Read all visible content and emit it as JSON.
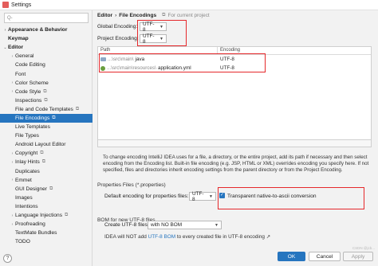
{
  "window": {
    "title": "Settings"
  },
  "search": {
    "placeholder": "Q-"
  },
  "sidebar": {
    "items": [
      {
        "label": "Appearance & Behavior",
        "arrow": "›",
        "level": 0,
        "bold": true
      },
      {
        "label": "Keymap",
        "arrow": "",
        "level": 0,
        "bold": true
      },
      {
        "label": "Editor",
        "arrow": "⌄",
        "level": 0,
        "bold": true
      },
      {
        "label": "General",
        "arrow": "›",
        "level": 1
      },
      {
        "label": "Code Editing",
        "arrow": "",
        "level": 1
      },
      {
        "label": "Font",
        "arrow": "",
        "level": 1
      },
      {
        "label": "Color Scheme",
        "arrow": "›",
        "level": 1
      },
      {
        "label": "Code Style",
        "arrow": "›",
        "level": 1,
        "scope": "⧉"
      },
      {
        "label": "Inspections",
        "arrow": "",
        "level": 1,
        "scope": "⧉"
      },
      {
        "label": "File and Code Templates",
        "arrow": "",
        "level": 1,
        "scope": "⧉"
      },
      {
        "label": "File Encodings",
        "arrow": "",
        "level": 1,
        "scope": "⧉",
        "selected": true
      },
      {
        "label": "Live Templates",
        "arrow": "",
        "level": 1
      },
      {
        "label": "File Types",
        "arrow": "",
        "level": 1
      },
      {
        "label": "Android Layout Editor",
        "arrow": "",
        "level": 1
      },
      {
        "label": "Copyright",
        "arrow": "›",
        "level": 1,
        "scope": "⧉"
      },
      {
        "label": "Inlay Hints",
        "arrow": "›",
        "level": 1,
        "scope": "⧉"
      },
      {
        "label": "Duplicates",
        "arrow": "",
        "level": 1
      },
      {
        "label": "Emmet",
        "arrow": "›",
        "level": 1
      },
      {
        "label": "GUI Designer",
        "arrow": "",
        "level": 1,
        "scope": "⧉"
      },
      {
        "label": "Images",
        "arrow": "",
        "level": 1
      },
      {
        "label": "Intentions",
        "arrow": "",
        "level": 1
      },
      {
        "label": "Language Injections",
        "arrow": "›",
        "level": 1,
        "scope": "⧉"
      },
      {
        "label": "Proofreading",
        "arrow": "›",
        "level": 1
      },
      {
        "label": "TextMate Bundles",
        "arrow": "",
        "level": 1
      },
      {
        "label": "TODO",
        "arrow": "",
        "level": 1
      }
    ]
  },
  "breadcrumb": {
    "parent": "Editor",
    "separator": "›",
    "current": "File Encodings",
    "scope_icon": "⧉",
    "scope_text": "For current project"
  },
  "encoding": {
    "global_label": "Global Encoding:",
    "global_value": "UTF-8",
    "project_label": "Project Encoding:",
    "project_value": "UTF-8"
  },
  "table": {
    "headers": [
      "Path",
      "Encoding"
    ],
    "rows": [
      {
        "path_prefix": "...\\src\\main\\",
        "path_name": "java",
        "encoding": "UTF-8",
        "icon": "folder-icon"
      },
      {
        "path_prefix": "...\\src\\main\\resources\\",
        "path_name": "application.yml",
        "encoding": "UTF-8",
        "icon": "yaml-file-icon"
      }
    ]
  },
  "info_text": "To change encoding IntelliJ IDEA uses for a file, a directory, or the entire project, add its path if necessary and then select encoding from the Encoding list. Built-in file encoding (e.g. JSP, HTML or XML) overrides encoding you specify here. If not specified, files and directories inherit encoding settings from the parent directory or from the Project Encoding.",
  "properties": {
    "section_title": "Properties Files (*.properties)",
    "default_label": "Default encoding for properties files:",
    "default_value": "UTF-8",
    "native_ascii_label": "Transparent native-to-ascii conversion",
    "native_ascii_checked": true
  },
  "bom": {
    "section_title": "BOM for new UTF-8 files",
    "create_label": "Create UTF-8 files:",
    "create_value": "with NO BOM",
    "note_prefix": "IDEA will NOT add",
    "note_link": "UTF-8 BOM",
    "note_suffix": "to every created file in UTF-8 encoding",
    "note_arrow": "↗"
  },
  "buttons": {
    "ok": "OK",
    "cancel": "Cancel",
    "apply": "Apply"
  },
  "help": "?",
  "watermark": "CSDN @jcb..."
}
